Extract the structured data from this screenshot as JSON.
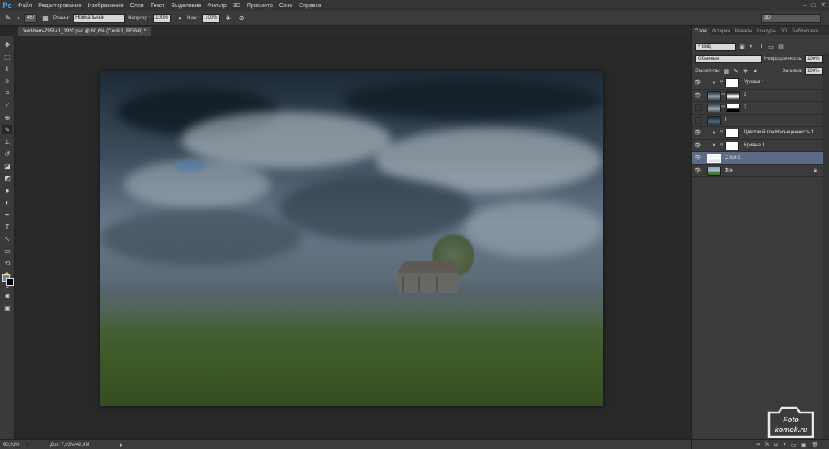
{
  "app": {
    "logo": "Ps"
  },
  "menu": {
    "items": [
      "Файл",
      "Редактирование",
      "Изображение",
      "Слои",
      "Текст",
      "Выделение",
      "Фильтр",
      "3D",
      "Просмотр",
      "Окно",
      "Справка"
    ]
  },
  "options": {
    "brush_size": "467",
    "mode_label": "Режим:",
    "mode_value": "Нормальный",
    "opacity_label": "Непрозр.:",
    "opacity_value": "100%",
    "flow_label": "Наж.:",
    "flow_value": "100%",
    "workspace": "3D"
  },
  "document": {
    "tab_title": "field-barn-795141_1920.psd @ 60,6% (Слой 1, RGB/8) *"
  },
  "status": {
    "zoom": "60,61%",
    "doc_info": "Док: 7,03M/42,4M"
  },
  "panel": {
    "tabs": [
      "Слои",
      "История",
      "Каналы",
      "Контуры",
      "3D",
      "Библиотеки"
    ],
    "filter_kind": "Вид",
    "blend_mode": "Обычные",
    "opacity_label": "Непрозрачность:",
    "opacity_value": "100%",
    "lock_label": "Закрепить:",
    "fill_label": "Заливка:",
    "fill_value": "100%"
  },
  "layers": [
    {
      "name": "Уровни 1",
      "visible": true,
      "type": "adjustment"
    },
    {
      "name": "3",
      "visible": true,
      "type": "masked"
    },
    {
      "name": "2",
      "visible": false,
      "type": "masked"
    },
    {
      "name": "1",
      "visible": false,
      "type": "image"
    },
    {
      "name": "Цветовой тон/Насыщенность 1",
      "visible": true,
      "type": "adjustment"
    },
    {
      "name": "Кривые 1",
      "visible": true,
      "type": "adjustment"
    },
    {
      "name": "Слой 1",
      "visible": true,
      "type": "image",
      "selected": true
    },
    {
      "name": "Фон",
      "visible": true,
      "type": "background",
      "locked": true
    }
  ],
  "watermark": {
    "line1": "Foto",
    "line2": "komok.ru"
  }
}
